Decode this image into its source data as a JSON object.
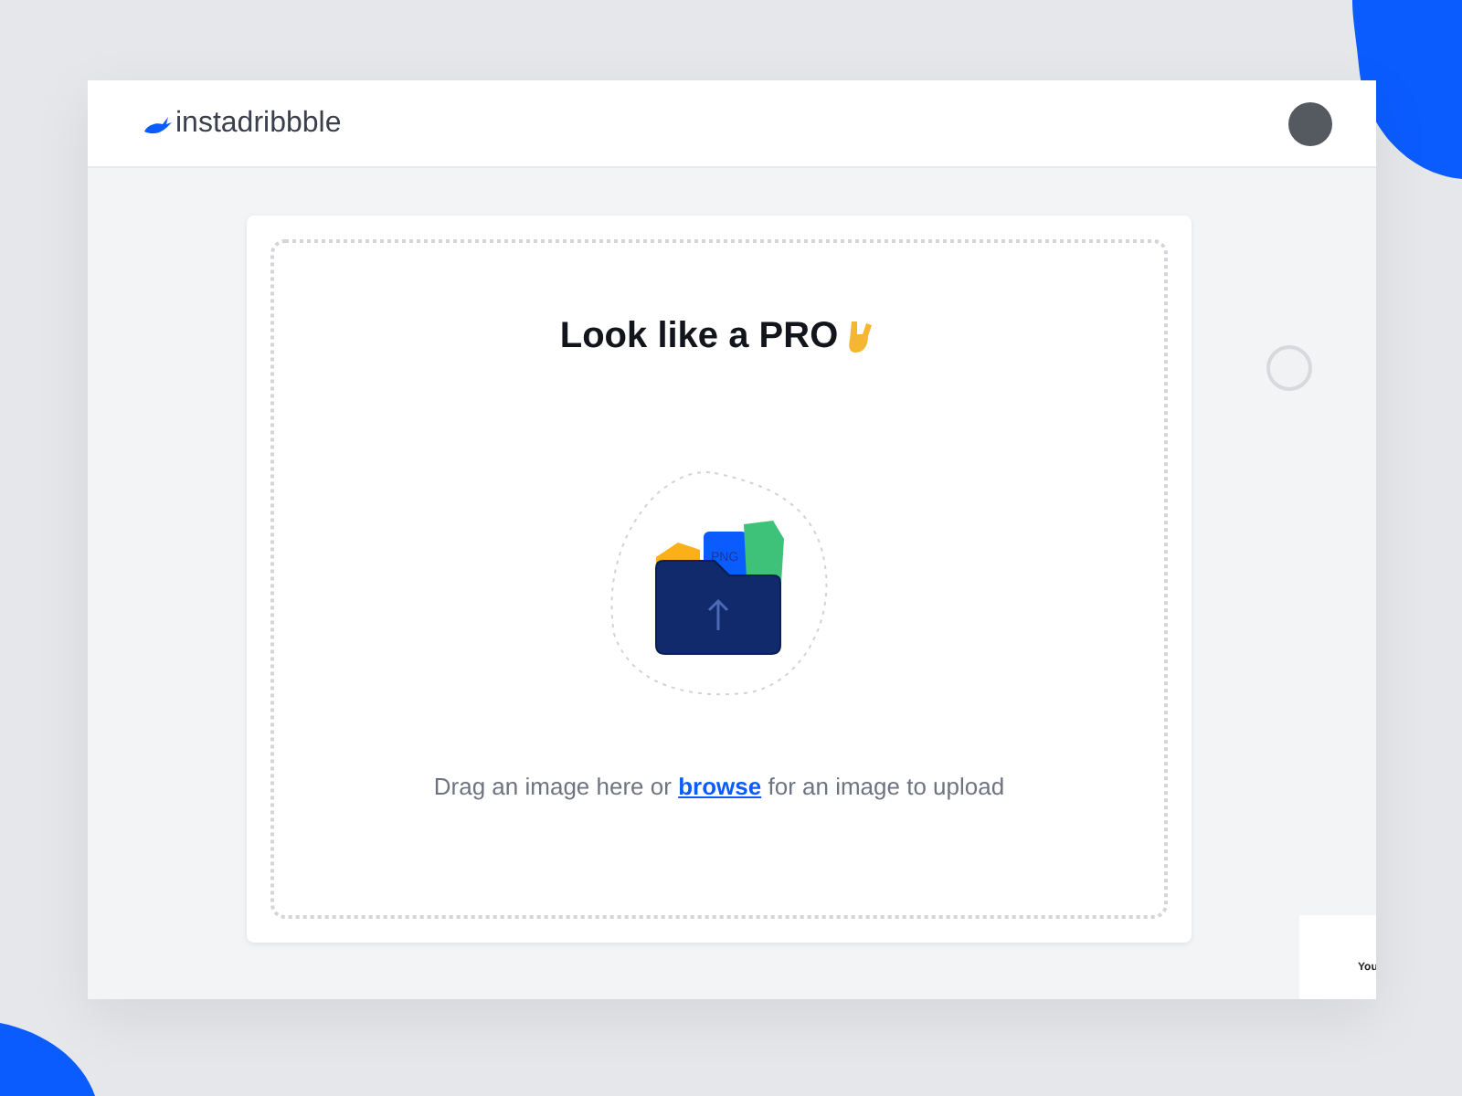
{
  "header": {
    "logo_text": "instadribbble"
  },
  "upload": {
    "title": "Look like a PRO",
    "file_label": "PNG",
    "hint_before": "Drag an image here or",
    "hint_link": "browse",
    "hint_after": "for an image to upload"
  },
  "side_card": {
    "text": "You"
  }
}
